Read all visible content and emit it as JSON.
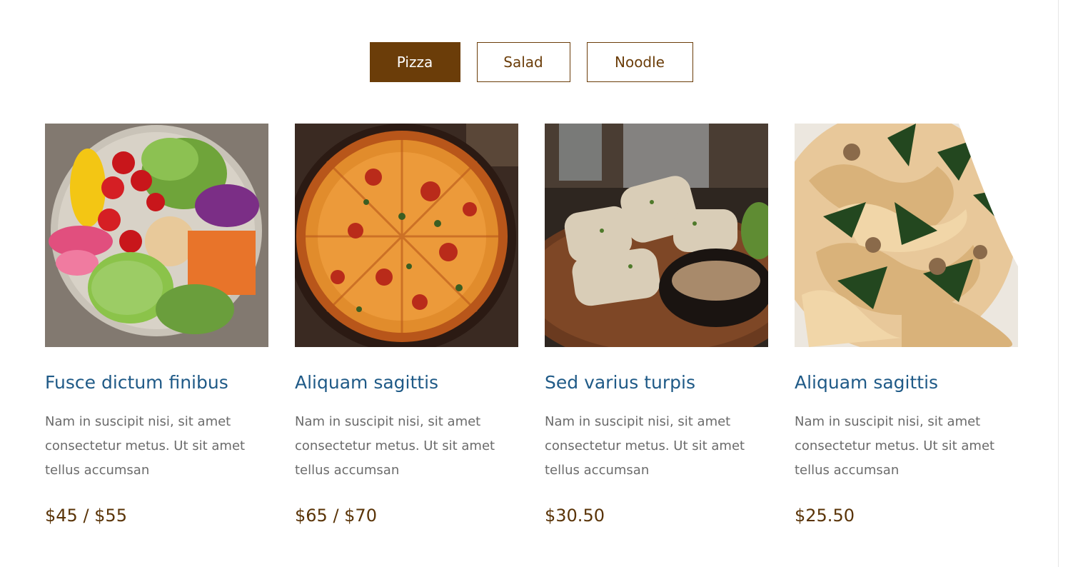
{
  "colors": {
    "accent": "#6b3d09",
    "title": "#1f5a87",
    "text": "#6b6b6b"
  },
  "tabs": [
    {
      "label": "Pizza",
      "active": true
    },
    {
      "label": "Salad",
      "active": false
    },
    {
      "label": "Noodle",
      "active": false
    }
  ],
  "cards": [
    {
      "title": "Fusce dictum finibus",
      "description": "Nam in suscipit nisi, sit amet consectetur metus. Ut sit amet tellus accumsan",
      "price": "$45 / $55",
      "image": "salad-bowl"
    },
    {
      "title": "Aliquam sagittis",
      "description": "Nam in suscipit nisi, sit amet consectetur metus. Ut sit amet tellus accumsan",
      "price": "$65 / $70",
      "image": "pizza"
    },
    {
      "title": "Sed varius turpis",
      "description": "Nam in suscipit nisi, sit amet consectetur metus. Ut sit amet tellus accumsan",
      "price": "$30.50",
      "image": "grilled-squid"
    },
    {
      "title": "Aliquam sagittis",
      "description": "Nam in suscipit nisi, sit amet consectetur metus. Ut sit amet tellus accumsan",
      "price": "$25.50",
      "image": "pasta"
    }
  ]
}
